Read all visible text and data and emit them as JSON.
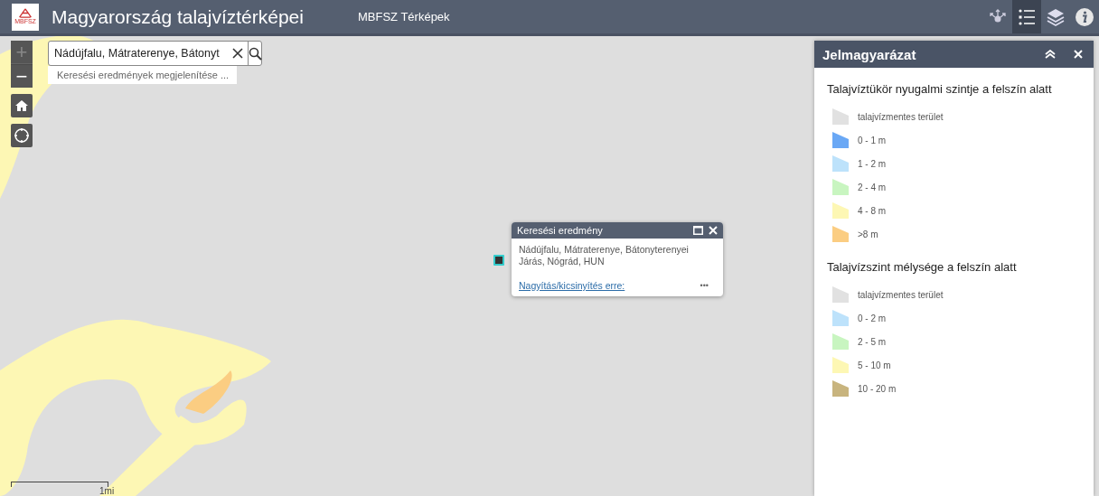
{
  "header": {
    "logo_text": "MBFSZ",
    "title": "Magyarország talajvíztérképei",
    "subtitle": "MBFSZ Térképek",
    "tools": [
      {
        "kind": "share",
        "selected": false
      },
      {
        "kind": "legend",
        "selected": true
      },
      {
        "kind": "layers",
        "selected": false
      },
      {
        "kind": "info",
        "selected": false
      }
    ]
  },
  "map": {
    "kind": "picture",
    "zoom": [
      {
        "kind": "in",
        "label": "+",
        "disabled": true
      },
      {
        "kind": "out",
        "label": "−",
        "disabled": false
      }
    ],
    "search": {
      "value": "Nádújfalu, Mátraterenye, Bátonyt",
      "suggestion": "Keresési eredmények megjelenítése ..."
    },
    "popup": {
      "title": "Keresési eredmény",
      "text": "Nádújfalu, Mátraterenye, Bátonyterenyei Járás, Nógrád, HUN",
      "link": "Nagyítás/kicsinyítés erre:",
      "more": "•••"
    },
    "scale": "1mi"
  },
  "legend": {
    "title": "Jelmagyarázat",
    "sections": [
      {
        "title": "Talajvíztükör nyugalmi szintje a felszín alatt",
        "items": [
          {
            "label": "talajvízmentes terület",
            "color": "#e1e1e1"
          },
          {
            "label": "0 - 1 m",
            "color": "#6aa8f5"
          },
          {
            "label": "1 - 2 m",
            "color": "#bde2fb"
          },
          {
            "label": "2 - 4 m",
            "color": "#c8f5c0"
          },
          {
            "label": "4 - 8 m",
            "color": "#fdf7b4"
          },
          {
            "label": ">8 m",
            "color": "#fbcd82"
          }
        ]
      },
      {
        "title": "Talajvízszint mélysége a felszín alatt",
        "items": [
          {
            "label": "talajvízmentes terület",
            "color": "#e1e1e1"
          },
          {
            "label": "0 - 2 m",
            "color": "#bde2fb"
          },
          {
            "label": "2 - 5 m",
            "color": "#c8f5c0"
          },
          {
            "label": "5 - 10 m",
            "color": "#fdf7b4"
          },
          {
            "label": "10 - 20 m",
            "color": "#c8b47e"
          }
        ]
      }
    ]
  }
}
